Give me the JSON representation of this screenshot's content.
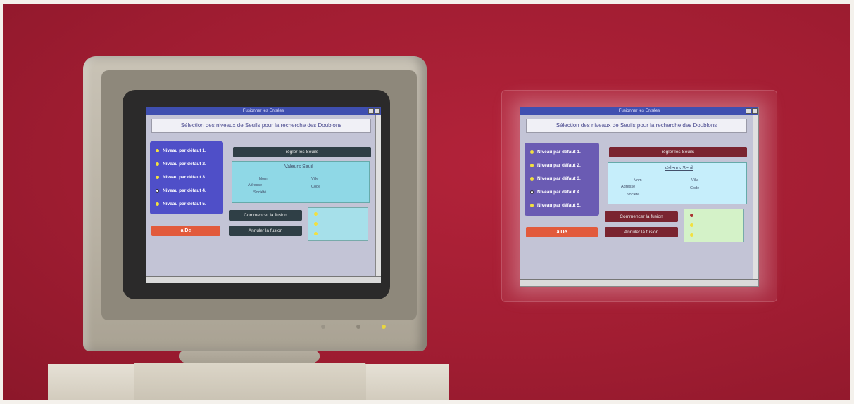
{
  "window": {
    "title": "Fusionner les Entrées"
  },
  "header": {
    "text": "Sélection des niveaux de Seuils pour la recherche des Doublons"
  },
  "levels": [
    {
      "label": "Niveau par défaut 1.",
      "selected": false
    },
    {
      "label": "Niveau par défaut 2.",
      "selected": false
    },
    {
      "label": "Niveau par défaut 3.",
      "selected": false
    },
    {
      "label": "Niveau par défaut 4.",
      "selected": true
    },
    {
      "label": "Niveau par défaut 5.",
      "selected": false
    }
  ],
  "buttons": {
    "regler_seuils": "régler les Seuils",
    "commencer": "Commencer la fusion",
    "annuler": "Annuler la fusion",
    "aide": "aiDe"
  },
  "thresholds": {
    "title": "Valeurs Seuil",
    "fields": [
      "Nom",
      "Ville",
      "Adresse",
      "Code",
      "Société"
    ]
  },
  "colors": {
    "background": "#a11d32",
    "panel_blue": "#4f4fc8",
    "button_red": "#e25a3c"
  }
}
